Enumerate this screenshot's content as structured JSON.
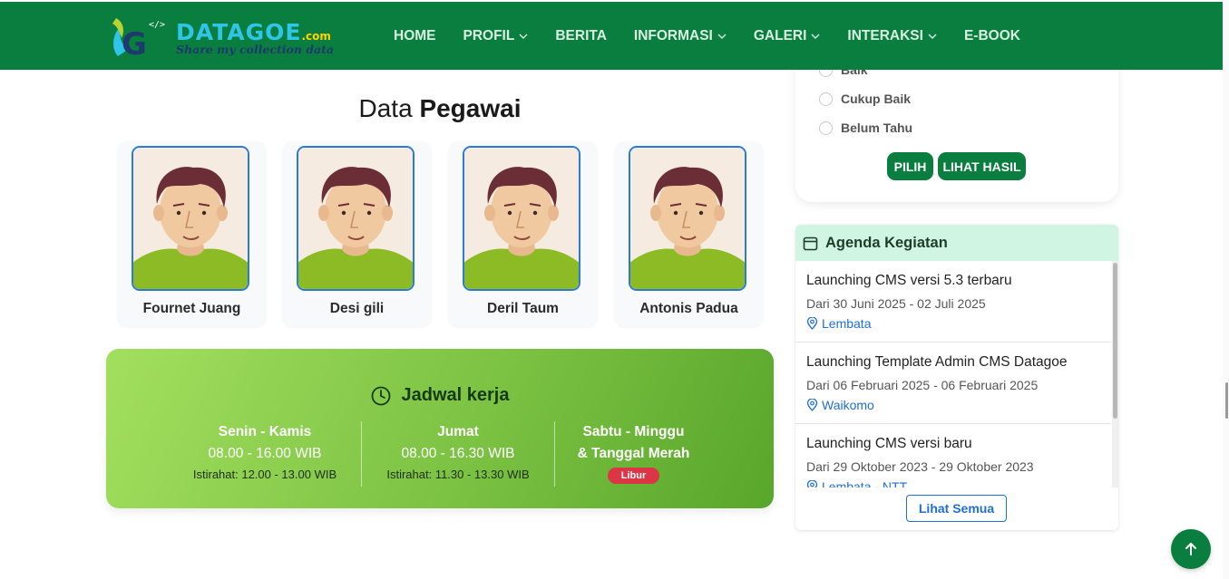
{
  "header": {
    "logo": {
      "brand": "DATAGOE",
      "tld": ".com",
      "tagline": "Share my collection data"
    },
    "nav": [
      {
        "label": "HOME",
        "dropdown": false
      },
      {
        "label": "PROFIL",
        "dropdown": true
      },
      {
        "label": "BERITA",
        "dropdown": false
      },
      {
        "label": "INFORMASI",
        "dropdown": true
      },
      {
        "label": "GALERI",
        "dropdown": true
      },
      {
        "label": "INTERAKSI",
        "dropdown": true
      },
      {
        "label": "E-BOOK",
        "dropdown": false
      }
    ]
  },
  "pegawai": {
    "title_plain": "Data",
    "title_bold": "Pegawai",
    "employees": [
      {
        "name": "Fournet Juang"
      },
      {
        "name": "Desi gili"
      },
      {
        "name": "Deril Taum"
      },
      {
        "name": "Antonis Padua"
      }
    ]
  },
  "jadwal": {
    "title": "Jadwal kerja",
    "columns": [
      {
        "days": "Senin - Kamis",
        "time": "08.00 - 16.00 WIB",
        "rest": "Istirahat: 12.00 - 13.00 WIB"
      },
      {
        "days": "Jumat",
        "time": "08.00 - 16.30 WIB",
        "rest": "Istirahat: 11.30 - 13.30 WIB"
      },
      {
        "days_line1": "Sabtu - Minggu",
        "days_line2": "& Tanggal Merah",
        "badge": "Libur"
      }
    ]
  },
  "poll": {
    "options": [
      "Baik",
      "Cukup Baik",
      "Belum Tahu"
    ],
    "pilih_label": "PILIH",
    "hasil_label": "LIHAT HASIL"
  },
  "agenda": {
    "title": "Agenda Kegiatan",
    "items": [
      {
        "title": "Launching CMS versi 5.3 terbaru",
        "date": "Dari 30 Juni 2025 - 02 Juli 2025",
        "location": "Lembata"
      },
      {
        "title": "Launching Template Admin CMS Datagoe",
        "date": "Dari 06 Februari 2025 - 06 Februari 2025",
        "location": "Waikomo"
      },
      {
        "title": "Launching CMS versi baru",
        "date": "Dari 29 Oktober 2023 - 29 Oktober 2023",
        "location": "Lembata - NTT"
      }
    ],
    "see_all_label": "Lihat Semua"
  },
  "colors": {
    "primary_green": "#0a7e3f",
    "agenda_header": "#d1f5e3",
    "link_blue": "#1f6fd1",
    "badge_red": "#dc3545"
  }
}
